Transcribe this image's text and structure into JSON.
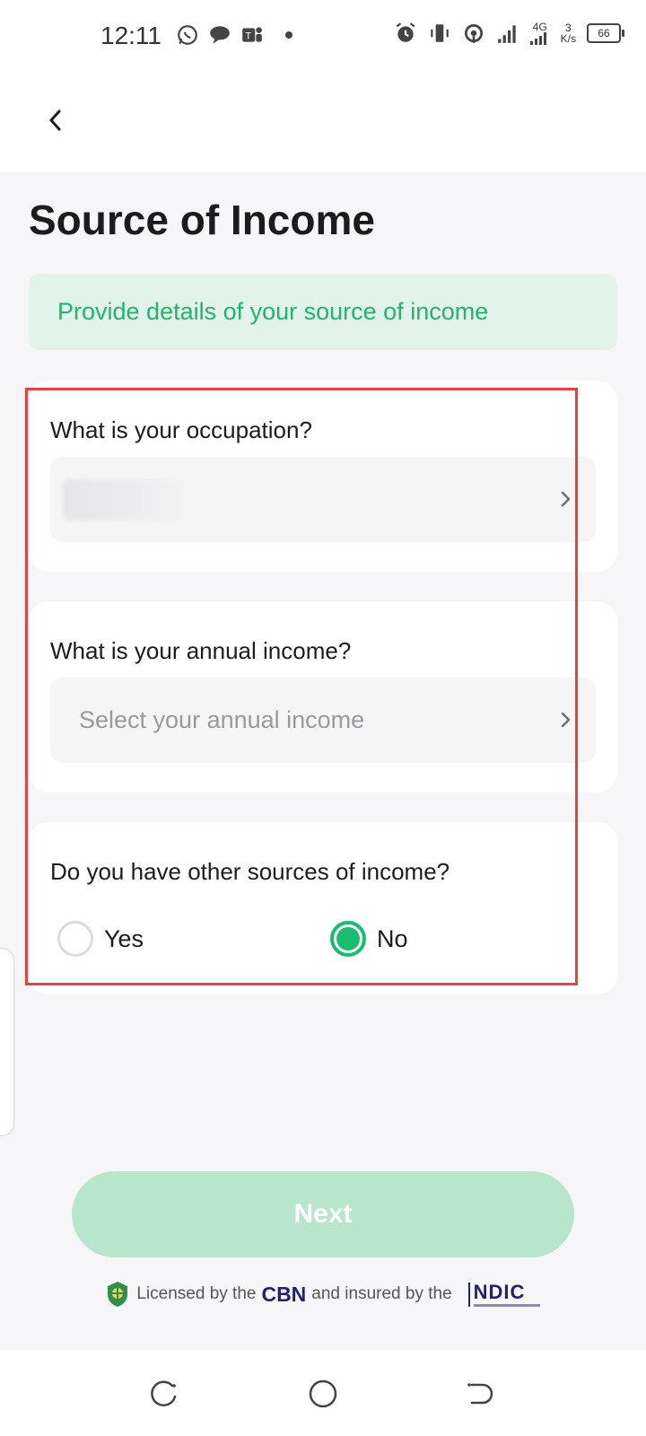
{
  "status_bar": {
    "time": "12:11",
    "net_type": "4G",
    "net_speed_value": "3",
    "net_speed_unit": "K/s",
    "battery": "66"
  },
  "header": {
    "title": "Source of Income"
  },
  "banner": {
    "text": "Provide details of your source of income"
  },
  "occupation": {
    "label": "What is your occupation?",
    "value": ""
  },
  "annual_income": {
    "label": "What is your annual income?",
    "placeholder": "Select your annual income"
  },
  "other_income": {
    "label": "Do you have other sources of income?",
    "options": [
      {
        "label": "Yes",
        "selected": false
      },
      {
        "label": "No",
        "selected": true
      }
    ]
  },
  "actions": {
    "next_label": "Next"
  },
  "footer": {
    "license_prefix": "Licensed by the",
    "cbn": "CBN",
    "license_middle": "and insured by the",
    "ndic": "NDIC"
  },
  "colors": {
    "accent": "#18bd70",
    "banner_bg": "#e2f3e9",
    "disabled_button": "#b8e6cd",
    "highlight": "#e8423f"
  }
}
